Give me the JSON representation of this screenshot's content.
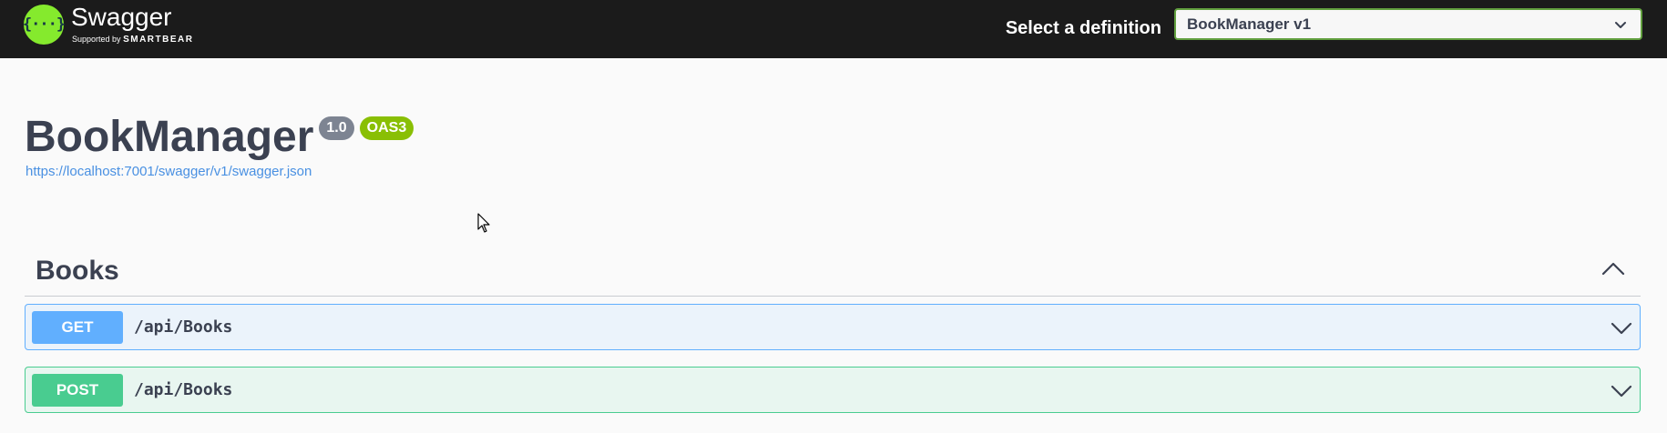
{
  "topbar": {
    "logo": {
      "glyph": "{···}",
      "name": "Swagger",
      "sub_prefix": "Supported by",
      "sub_brand": "SMARTBEAR"
    },
    "definition_label": "Select a definition",
    "definition_selected": "BookManager v1"
  },
  "info": {
    "title": "BookManager",
    "version": "1.0",
    "oas": "OAS3",
    "spec_url": "https://localhost:7001/swagger/v1/swagger.json"
  },
  "tags": [
    {
      "name": "Books",
      "operations": [
        {
          "method": "GET",
          "path": "/api/Books"
        },
        {
          "method": "POST",
          "path": "/api/Books"
        }
      ]
    }
  ],
  "colors": {
    "get": "#61affe",
    "post": "#49cc90",
    "topbar": "#1b1b1b",
    "logo": "#85ea2d"
  }
}
